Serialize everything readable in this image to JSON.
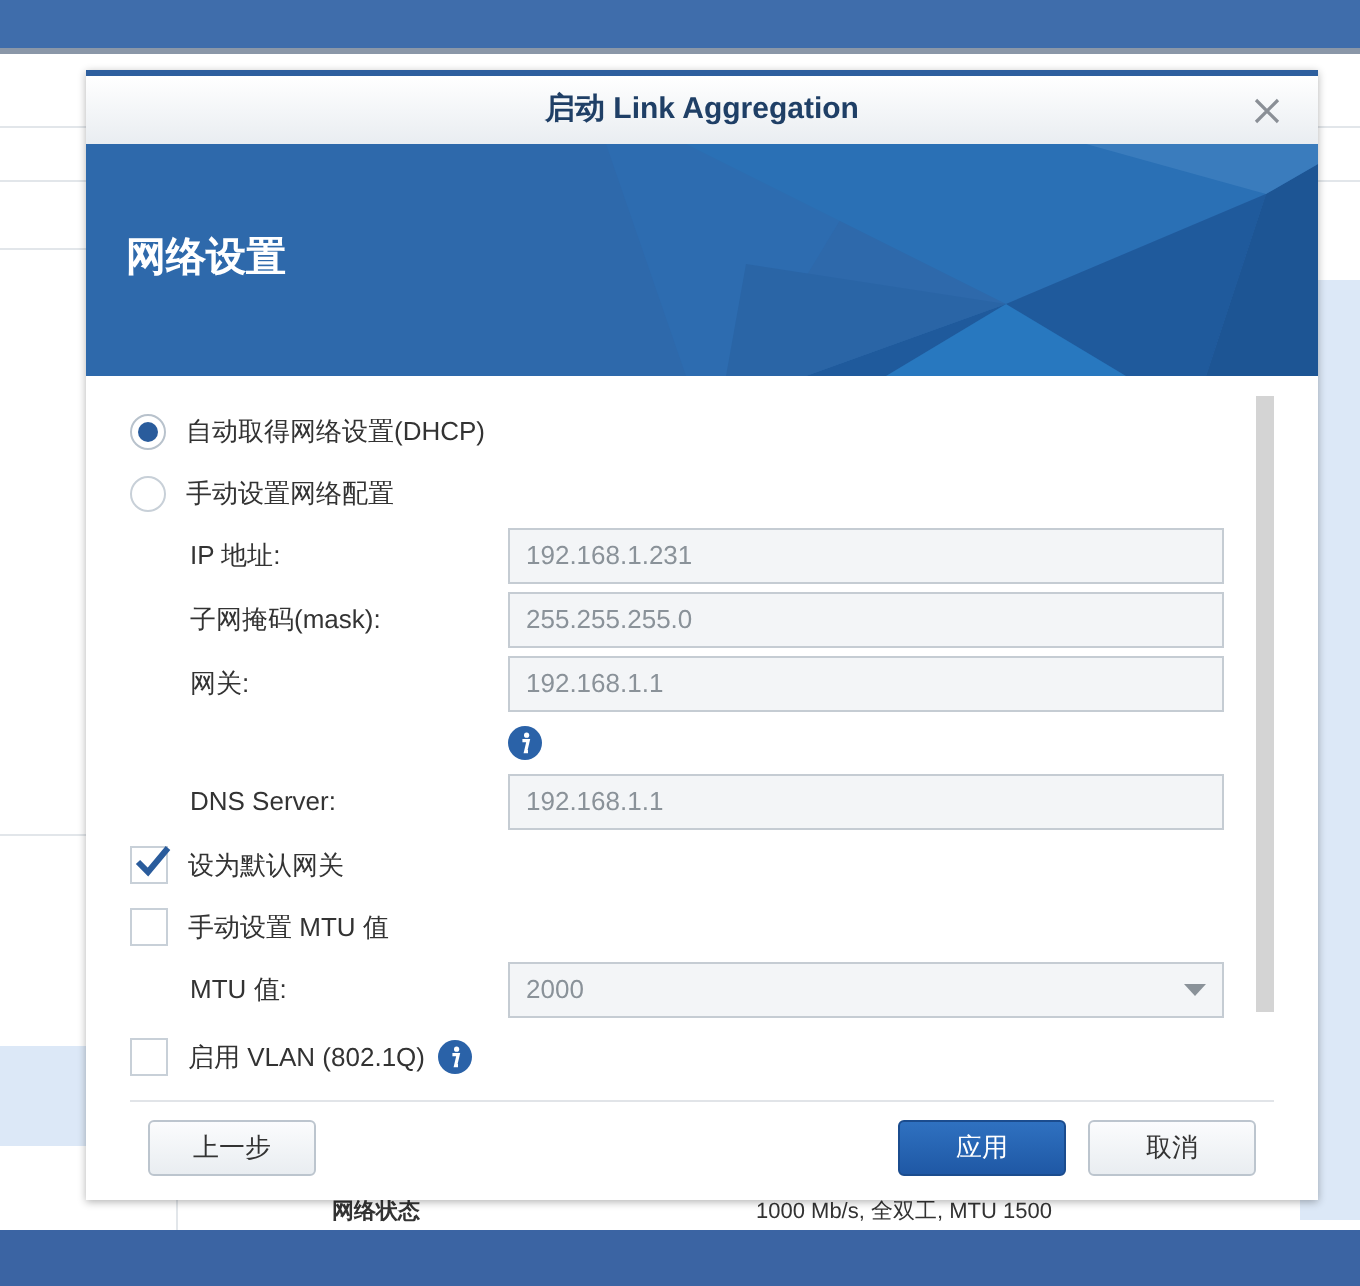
{
  "background": {
    "status_label": "网络状态",
    "status_value": "1000 Mb/s, 全双工, MTU 1500"
  },
  "dialog": {
    "title": "启动 Link Aggregation",
    "banner_title": "网络设置",
    "network_mode": [
      {
        "label": "自动取得网络设置(DHCP)",
        "selected": true
      },
      {
        "label": "手动设置网络配置",
        "selected": false
      }
    ],
    "rows": [
      {
        "kind": "field",
        "label": "IP 地址:",
        "value": "192.168.1.231",
        "disabled": true,
        "info": false
      },
      {
        "kind": "field",
        "label": "子网掩码(mask):",
        "value": "255.255.255.0",
        "disabled": true,
        "info": false
      },
      {
        "kind": "field",
        "label": "网关:",
        "value": "192.168.1.1",
        "disabled": true,
        "info": true
      },
      {
        "kind": "field",
        "label": "DNS Server:",
        "value": "192.168.1.1",
        "disabled": true,
        "info": false
      },
      {
        "kind": "checkbox",
        "label": "设为默认网关",
        "checked": true,
        "info": false
      },
      {
        "kind": "checkbox",
        "label": "手动设置 MTU 值",
        "checked": false,
        "info": false
      },
      {
        "kind": "select",
        "label": "MTU 值:",
        "value": "2000",
        "disabled": true,
        "info": false
      },
      {
        "kind": "checkbox",
        "label": "启用 VLAN (802.1Q)",
        "checked": false,
        "info": true
      }
    ],
    "buttons": [
      {
        "label": "上一步",
        "kind": "secondary"
      },
      {
        "label": "应用",
        "kind": "primary"
      },
      {
        "label": "取消",
        "kind": "secondary"
      }
    ]
  }
}
